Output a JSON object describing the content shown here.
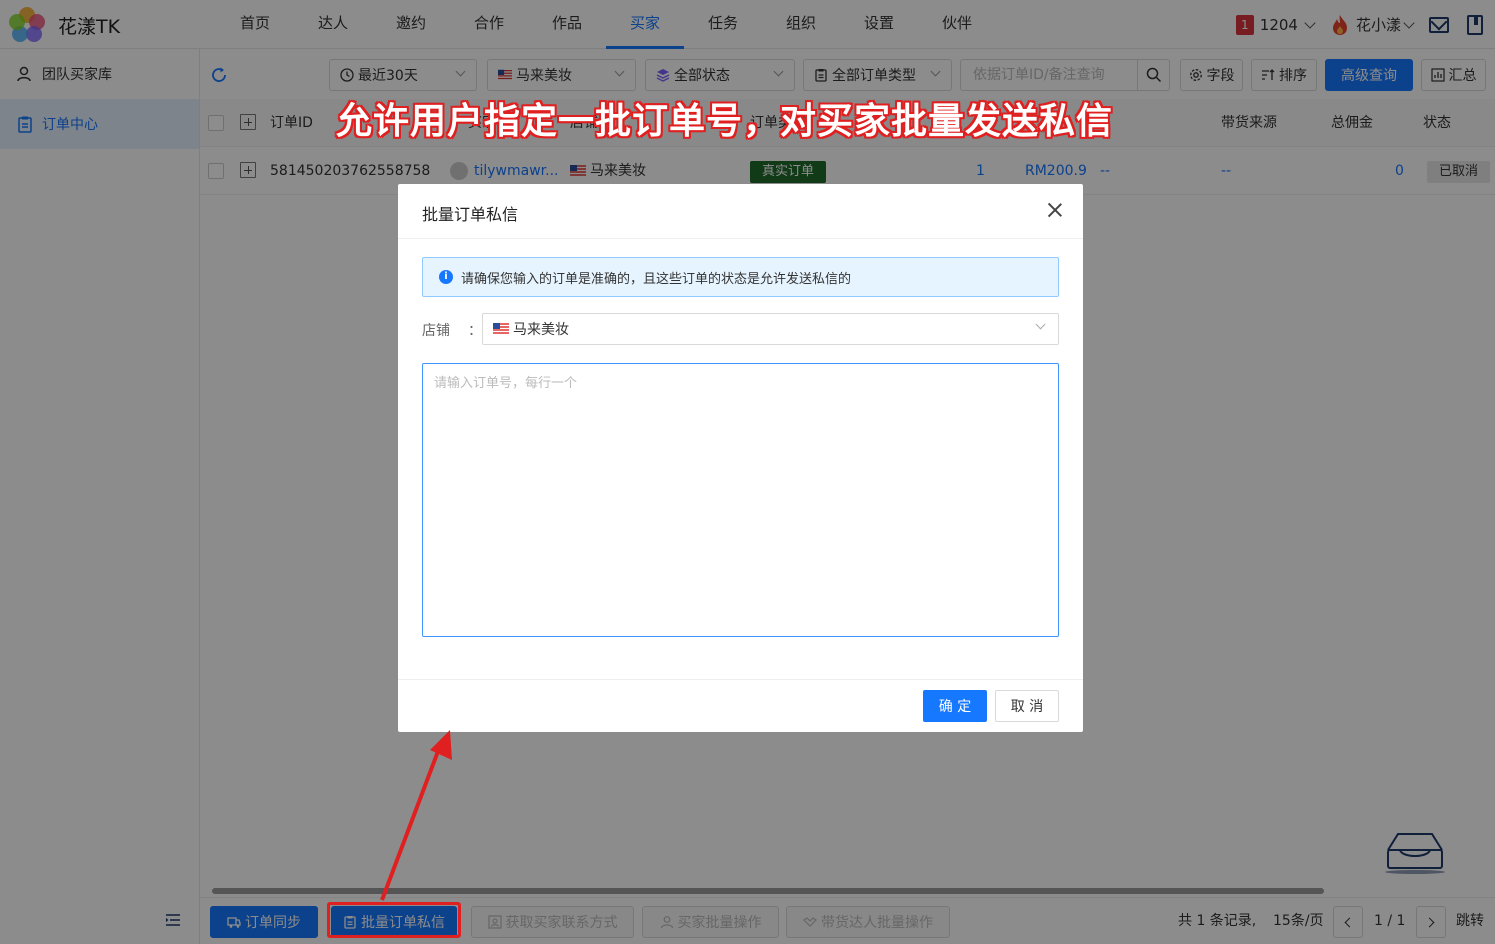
{
  "app": {
    "title": "花漾TK"
  },
  "nav": {
    "items": [
      "首页",
      "达人",
      "邀约",
      "合作",
      "作品",
      "买家",
      "任务",
      "组织",
      "设置",
      "伙伴"
    ],
    "active_index": 5
  },
  "header": {
    "badge_count": "1",
    "badge_value": "1204",
    "user_name": "花小漾"
  },
  "sidebar": {
    "items": [
      {
        "label": "团队买家库"
      },
      {
        "label": "订单中心"
      }
    ],
    "active_index": 1
  },
  "toolbar": {
    "date_filter": "最近30天",
    "shop_filter": "马来美妆",
    "status_filter": "全部状态",
    "type_filter": "全部订单类型",
    "search_placeholder": "依据订单ID/备注查询",
    "fields_label": "字段",
    "sort_label": "排序",
    "advanced_label": "高级查询",
    "summary_label": "汇总"
  },
  "table": {
    "headers": {
      "order_id": "订单ID",
      "buyer": "买家ID",
      "shop": "店铺",
      "order_type": "订单类型",
      "source": "带货来源",
      "commission": "总佣金",
      "status": "状态"
    },
    "rows": [
      {
        "order_id": "581450203762558758",
        "buyer": "tilywmawr...",
        "shop": "马来美妆",
        "order_type": "真实订单",
        "qty": "1",
        "amount": "RM200.9",
        "creator": "--",
        "source": "--",
        "commission": "0",
        "status": "已取消"
      }
    ]
  },
  "modal": {
    "title": "批量订单私信",
    "alert": "请确保您输入的订单是准确的，且这些订单的状态是允许发送私信的",
    "shop_label": "店铺",
    "shop_colon": "：",
    "shop_value": "马来美妆",
    "textarea_placeholder": "请输入订单号，每行一个",
    "ok_label": "确 定",
    "cancel_label": "取 消"
  },
  "bottombar": {
    "sync_label": "订单同步",
    "batch_msg_label": "批量订单私信",
    "contact_label": "获取买家联系方式",
    "buyer_batch_label": "买家批量操作",
    "creator_batch_label": "带货达人批量操作",
    "record_info": "共 1 条记录,",
    "page_size": "15条/页",
    "page_indicator": "1 / 1",
    "jump_label": "跳转"
  },
  "annotation": {
    "text": "允许用户指定一批订单号，对买家批量发送私信"
  },
  "colors": {
    "primary": "#1677ff",
    "annotation_red": "#e02020",
    "tag_green": "#1f6b2a"
  }
}
